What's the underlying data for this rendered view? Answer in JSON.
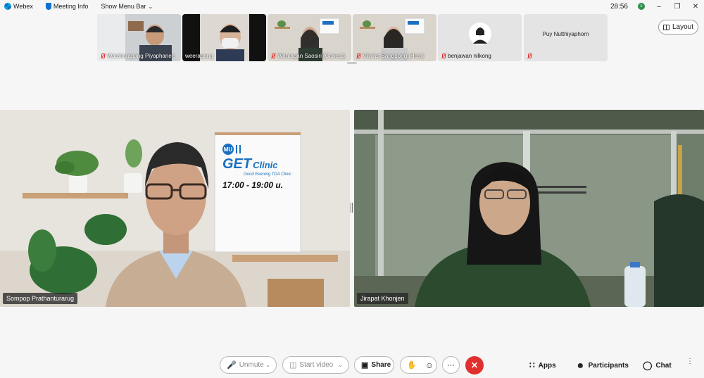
{
  "titlebar": {
    "app_name": "Webex",
    "meeting_info": "Meeting Info",
    "menu_bar": "Show Menu Bar",
    "timer": "28:56",
    "recording_badge": "c"
  },
  "thumbnails": [
    {
      "name": "Watcharapong Piyaphanee",
      "muted": true
    },
    {
      "name": "weerapong",
      "muted": false
    },
    {
      "name": "Wantagan Saosiri (Cohost)",
      "muted": true
    },
    {
      "name": "Vilairat Sangpong (Host)",
      "muted": true
    },
    {
      "name": "benjawan nilkong",
      "muted": true
    },
    {
      "name": "Puy Nutthiyaphorn",
      "muted": true
    }
  ],
  "layout_button": "Layout",
  "main_tiles": [
    {
      "name": "Sompop Prathanturarug",
      "poster": {
        "badge": "MU",
        "brand_a": "GE",
        "brand_b": "T",
        "brand_c": "Clinic",
        "tagline": "Good Evening TDA Clinic",
        "hours": "17:00 - 19:00 u."
      }
    },
    {
      "name": "Jirapat Khonjen"
    }
  ],
  "toolbar": {
    "unmute": "Unmute",
    "start_video": "Start video",
    "share": "Share",
    "apps": "Apps",
    "participants": "Participants",
    "chat": "Chat"
  },
  "colors": {
    "end_call": "#e0302e",
    "accent": "#1170cf",
    "background": "#f6f6f6"
  }
}
